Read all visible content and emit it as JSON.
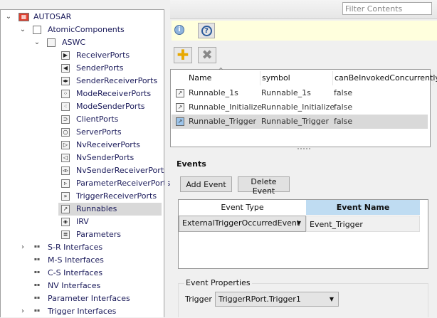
{
  "tree": [
    {
      "label": "AUTOSAR",
      "depth": 0,
      "chev": true,
      "icon": "autosar-root-icon",
      "glyph": "▦"
    },
    {
      "label": "AtomicComponents",
      "depth": 1,
      "chev": true,
      "icon": "components-icon",
      "glyph": ""
    },
    {
      "label": "ASWC",
      "depth": 2,
      "chev": true,
      "icon": "component-icon",
      "glyph": ""
    },
    {
      "label": "ReceiverPorts",
      "depth": 3,
      "icon": "receiver-port-icon",
      "glyph": "▶"
    },
    {
      "label": "SenderPorts",
      "depth": 3,
      "icon": "sender-port-icon",
      "glyph": "◀"
    },
    {
      "label": "SenderReceiverPorts",
      "depth": 3,
      "icon": "sender-receiver-port-icon",
      "glyph": "◂▸"
    },
    {
      "label": "ModeReceiverPorts",
      "depth": 3,
      "icon": "mode-receiver-port-icon",
      "glyph": "⁘"
    },
    {
      "label": "ModeSenderPorts",
      "depth": 3,
      "icon": "mode-sender-port-icon",
      "glyph": "⁖"
    },
    {
      "label": "ClientPorts",
      "depth": 3,
      "icon": "client-port-icon",
      "glyph": "⊃"
    },
    {
      "label": "ServerPorts",
      "depth": 3,
      "icon": "server-port-icon",
      "glyph": "○"
    },
    {
      "label": "NvReceiverPorts",
      "depth": 3,
      "icon": "nv-receiver-port-icon",
      "glyph": "▷"
    },
    {
      "label": "NvSenderPorts",
      "depth": 3,
      "icon": "nv-sender-port-icon",
      "glyph": "◁"
    },
    {
      "label": "NvSenderReceiverPorts",
      "depth": 3,
      "icon": "nv-sender-receiver-port-icon",
      "glyph": "◃▹"
    },
    {
      "label": "ParameterReceiverPorts",
      "depth": 3,
      "icon": "parameter-receiver-port-icon",
      "glyph": "▹"
    },
    {
      "label": "TriggerReceiverPorts",
      "depth": 3,
      "icon": "trigger-receiver-port-icon",
      "glyph": "»"
    },
    {
      "label": "Runnables",
      "depth": 3,
      "icon": "runnable-icon",
      "glyph": "↗",
      "selected": true
    },
    {
      "label": "IRV",
      "depth": 3,
      "icon": "irv-icon",
      "glyph": "◈"
    },
    {
      "label": "Parameters",
      "depth": 3,
      "icon": "parameters-icon",
      "glyph": "≣"
    },
    {
      "label": "S-R Interfaces",
      "depth": 1,
      "chev": "collapsed",
      "icon": "interfaces-icon",
      "glyph": "▪▪"
    },
    {
      "label": "M-S Interfaces",
      "depth": 1,
      "icon": "interfaces-icon",
      "glyph": "▪▪"
    },
    {
      "label": "C-S Interfaces",
      "depth": 1,
      "icon": "interfaces-icon",
      "glyph": "▪▪"
    },
    {
      "label": "NV Interfaces",
      "depth": 1,
      "icon": "interfaces-icon",
      "glyph": "▪▪"
    },
    {
      "label": "Parameter Interfaces",
      "depth": 1,
      "icon": "interfaces-icon",
      "glyph": "▪▪"
    },
    {
      "label": "Trigger Interfaces",
      "depth": 1,
      "chev": "collapsed",
      "icon": "interfaces-icon",
      "glyph": "▪▪"
    }
  ],
  "filter": {
    "placeholder": "Filter Contents"
  },
  "runnables": {
    "columns": [
      "Name",
      "symbol",
      "canBeInvokedConcurrently"
    ],
    "rows": [
      {
        "name": "Runnable_1s",
        "symbol": "Runnable_1s",
        "concurrent": "false"
      },
      {
        "name": "Runnable_Initialize",
        "symbol": "Runnable_Initialize",
        "concurrent": "false"
      },
      {
        "name": "Runnable_Trigger",
        "symbol": "Runnable_Trigger",
        "concurrent": "false",
        "selected": true
      }
    ]
  },
  "events": {
    "title": "Events",
    "add_label": "Add Event",
    "delete_label": "Delete Event",
    "col_type": "Event Type",
    "col_name": "Event Name",
    "row": {
      "type": "ExternalTriggerOccurredEvent",
      "name": "Event_Trigger"
    },
    "header_highlight": "#bfdcf2"
  },
  "props": {
    "title": "Event Properties",
    "trigger_label": "Trigger",
    "trigger_value": "TriggerRPort.Trigger1"
  }
}
